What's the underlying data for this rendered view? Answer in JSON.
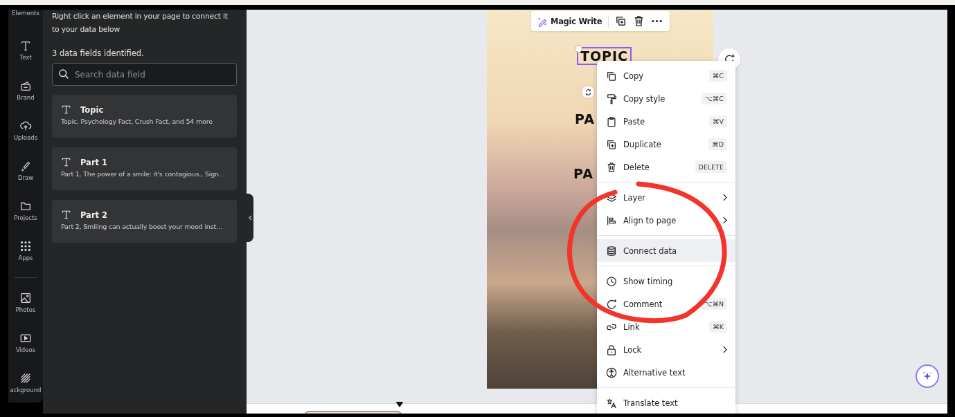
{
  "nav_rail": {
    "items": [
      {
        "label": "Elements"
      },
      {
        "label": "Text"
      },
      {
        "label": "Brand"
      },
      {
        "label": "Uploads"
      },
      {
        "label": "Draw"
      },
      {
        "label": "Projects"
      },
      {
        "label": "Apps"
      },
      {
        "label": "Photos"
      },
      {
        "label": "Videos"
      },
      {
        "label": "ackground"
      }
    ]
  },
  "panel": {
    "instruction": "Right click an element in your page to connect it to your data below",
    "count": "3 data fields identified.",
    "search": {
      "placeholder": "Search data field"
    },
    "fields": [
      {
        "name": "Topic",
        "values": "Topic, Psychology Fact, Crush Fact, and 54 more"
      },
      {
        "name": "Part 1",
        "values": "Part 1, The power of a smile: it's contagious., Sign…"
      },
      {
        "name": "Part 2",
        "values": "Part 2, Smiling can actually boost your mood inst…"
      }
    ]
  },
  "toolbar": {
    "magic_write": "Magic Write"
  },
  "design": {
    "texts": [
      {
        "text": "TOPIC",
        "selected": true
      },
      {
        "text": "PA",
        "selected": false
      },
      {
        "text": "PA",
        "selected": false
      }
    ]
  },
  "context_menu": {
    "groups": [
      {
        "items": [
          {
            "label": "Copy",
            "shortcut": "⌘C",
            "selected": false
          },
          {
            "label": "Copy style",
            "shortcut": "⌥⌘C",
            "selected": false
          },
          {
            "label": "Paste",
            "shortcut": "⌘V",
            "selected": false
          },
          {
            "label": "Duplicate",
            "shortcut": "⌘D",
            "selected": false
          },
          {
            "label": "Delete",
            "shortcut": "DELETE",
            "selected": false
          }
        ]
      },
      {
        "items": [
          {
            "label": "Layer",
            "submenu": true,
            "selected": false
          },
          {
            "label": "Align to page",
            "submenu": true,
            "selected": false
          }
        ]
      },
      {
        "items": [
          {
            "label": "Connect data",
            "selected": true
          }
        ]
      },
      {
        "items": [
          {
            "label": "Show timing",
            "selected": false
          },
          {
            "label": "Comment",
            "shortcut": "⌥⌘N",
            "selected": false
          },
          {
            "label": "Link",
            "shortcut": "⌘K",
            "selected": false
          },
          {
            "label": "Lock",
            "submenu": true,
            "selected": false
          },
          {
            "label": "Alternative text",
            "selected": false
          }
        ]
      },
      {
        "items": [
          {
            "label": "Translate text",
            "selected": false
          }
        ]
      }
    ]
  }
}
